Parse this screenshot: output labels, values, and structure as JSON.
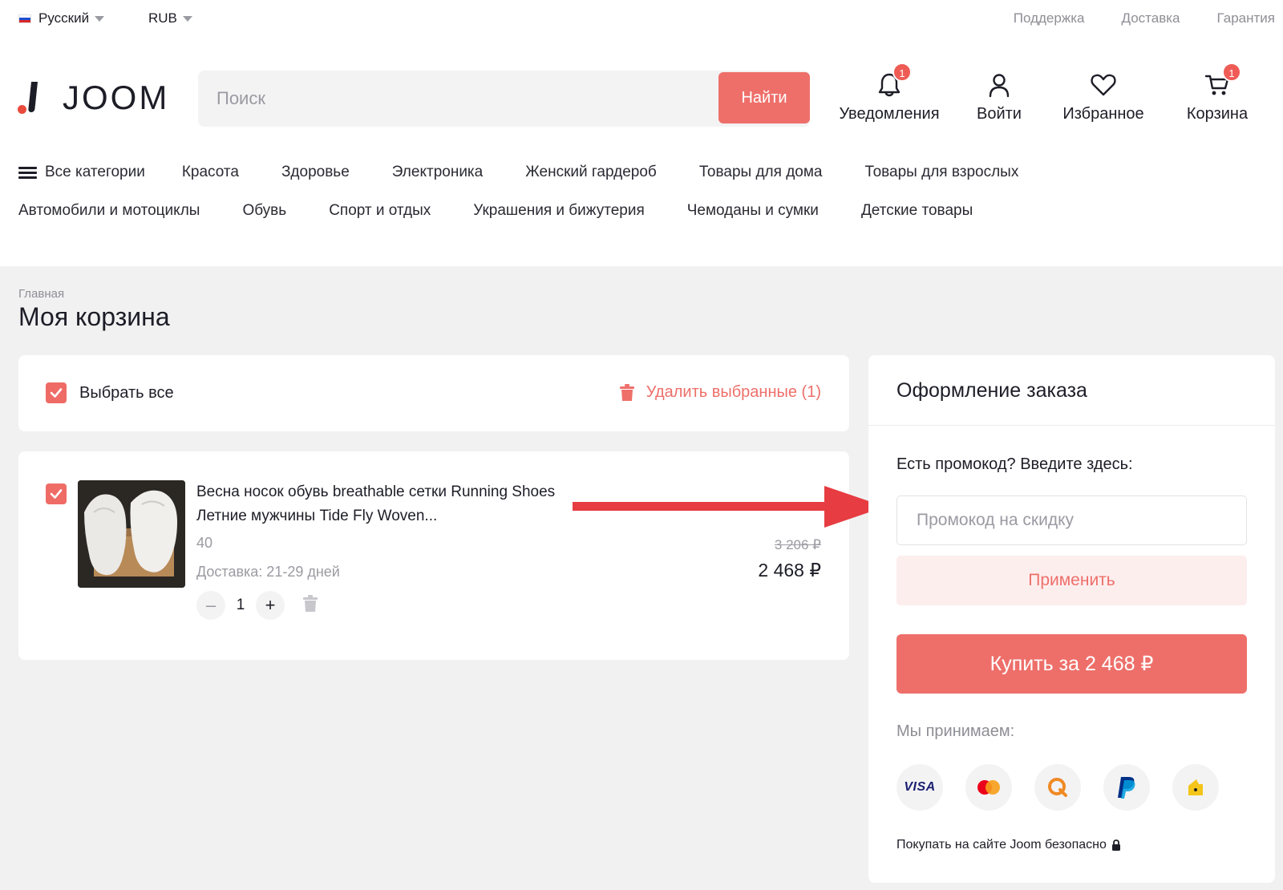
{
  "topbar": {
    "language": "Русский",
    "currency": "RUB",
    "links": [
      "Поддержка",
      "Доставка",
      "Гарантия"
    ]
  },
  "header": {
    "logo_text": "JOOM",
    "search_placeholder": "Поиск",
    "search_button": "Найти",
    "actions": {
      "notifications": {
        "label": "Уведомления",
        "badge": "1"
      },
      "login": {
        "label": "Войти"
      },
      "favorites": {
        "label": "Избранное"
      },
      "cart": {
        "label": "Корзина",
        "badge": "1"
      }
    }
  },
  "categories": {
    "all": "Все категории",
    "row1": [
      "Красота",
      "Здоровье",
      "Электроника",
      "Женский гардероб",
      "Товары для дома",
      "Товары для взрослых"
    ],
    "row2": [
      "Автомобили и мотоциклы",
      "Обувь",
      "Спорт и отдых",
      "Украшения и бижутерия",
      "Чемоданы и сумки",
      "Детские товары"
    ]
  },
  "page": {
    "breadcrumb": "Главная",
    "title": "Моя корзина"
  },
  "cart": {
    "select_all": "Выбрать все",
    "delete_selected": "Удалить выбранные (1)",
    "item": {
      "title": "Весна носок обувь breathable сетки Running Shoes Летние мужчины Tide Fly Woven...",
      "size": "40",
      "delivery": "Доставка: 21-29 дней",
      "quantity": "1",
      "old_price": "3 206 ₽",
      "price": "2 468 ₽"
    }
  },
  "order": {
    "heading": "Оформление заказа",
    "promo_label": "Есть промокод? Введите здесь:",
    "promo_placeholder": "Промокод на скидку",
    "apply_button": "Применить",
    "buy_button": "Купить за 2 468 ₽",
    "accept_label": "Мы принимаем:",
    "payment_methods": [
      "VISA",
      "mastercard-icon",
      "qiwi-icon",
      "paypal-icon",
      "yandex-money-icon"
    ],
    "secure_text": "Покупать на сайте Joom безопасно"
  },
  "colors": {
    "accent": "#ee6f6a",
    "badge": "#ef5b55",
    "arrow": "#e63c42",
    "apply_bg": "#fdeeee",
    "page_bg": "#f1f1f2"
  }
}
